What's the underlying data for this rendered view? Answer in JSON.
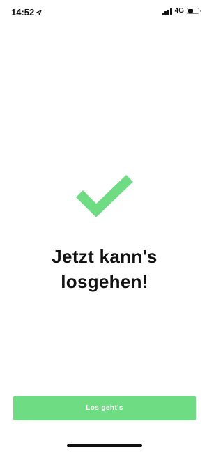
{
  "status_bar": {
    "time": "14:52",
    "network": "4G",
    "location_icon": "location-arrow-icon",
    "signal_icon": "cellular-signal-icon",
    "battery_icon": "battery-icon",
    "signal_bars": 4,
    "battery_level": 0.5
  },
  "main": {
    "icon": "checkmark-icon",
    "headline_line1": "Jetzt kann's",
    "headline_line2": "losgehen!"
  },
  "footer": {
    "button_label": "Los geht's"
  },
  "colors": {
    "accent": "#6ddc82",
    "text": "#111111",
    "background": "#ffffff"
  }
}
